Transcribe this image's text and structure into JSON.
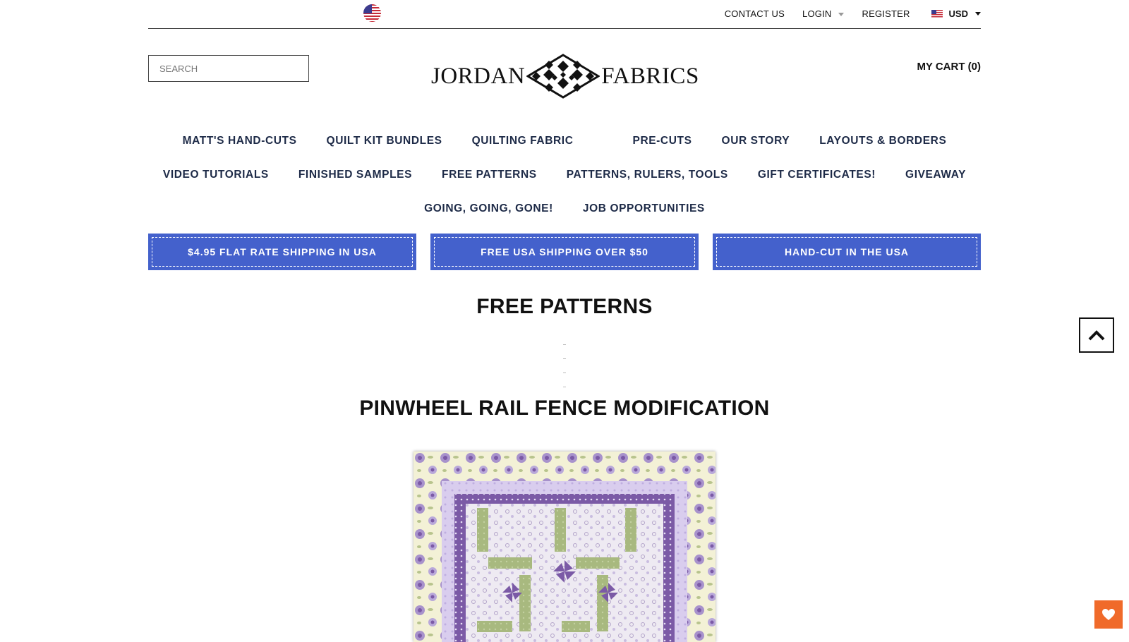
{
  "topbar": {
    "contact": "CONTACT US",
    "login": "LOGIN",
    "register": "REGISTER",
    "currency": "USD"
  },
  "header": {
    "search_placeholder": "SEARCH",
    "logo_left": "JORDAN",
    "logo_right": "FABRICS",
    "cart": "MY CART (0)"
  },
  "nav": {
    "row1": [
      "MATT'S HAND-CUTS",
      "QUILT KIT BUNDLES",
      "QUILTING FABRIC",
      "PRE-CUTS",
      "OUR STORY",
      "LAYOUTS & BORDERS"
    ],
    "row2": [
      "VIDEO TUTORIALS",
      "FINISHED SAMPLES",
      "FREE PATTERNS",
      "PATTERNS, RULERS, TOOLS",
      "GIFT CERTIFICATES!",
      "GIVEAWAY"
    ],
    "row3": [
      "GOING, GOING, GONE!",
      "JOB OPPORTUNITIES"
    ]
  },
  "promos": [
    "$4.95 FLAT RATE SHIPPING IN USA",
    "FREE USA SHIPPING OVER $50",
    "HAND-CUT IN THE USA"
  ],
  "main": {
    "title": "FREE PATTERNS",
    "pattern_title": "PINWHEEL RAIL FENCE MODIFICATION"
  },
  "icons": {
    "flag": "us-flag-icon",
    "back_to_top": "chevron-up-icon",
    "wishlist": "heart-icon"
  },
  "colors": {
    "promo_bg": "#4461cc",
    "nav_text": "#1d2a47",
    "wishlist_bg": "#f06a2a",
    "quilt_purple": "#7b5aa6",
    "quilt_lavender": "#d9cdee",
    "quilt_green": "#a8b97f",
    "quilt_cream": "#f3f1d6"
  }
}
